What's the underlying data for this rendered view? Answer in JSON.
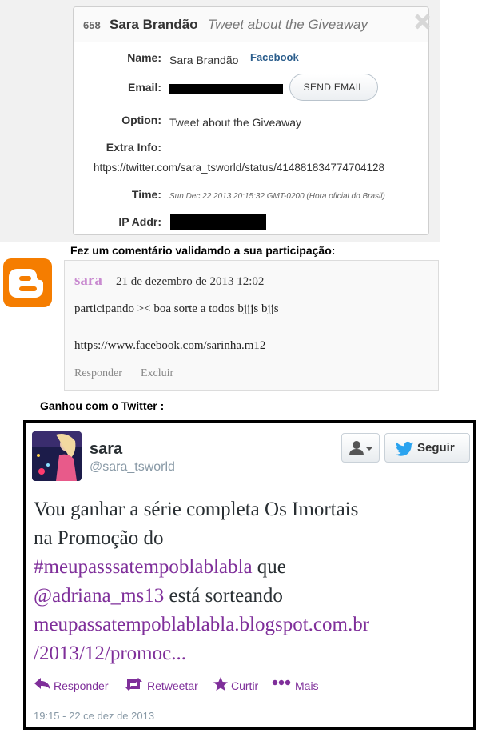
{
  "entry": {
    "id": "658",
    "name": "Sara Brandão",
    "option_title": "Tweet about the Giveaway",
    "labels": {
      "name": "Name:",
      "email": "Email:",
      "option": "Option:",
      "extra": "Extra Info:",
      "time": "Time:",
      "ip": "IP Addr:"
    },
    "name_value": "Sara Brandão",
    "facebook_link": "Facebook",
    "send_email_label": "SEND EMAIL",
    "option_value": "Tweet about the Giveaway",
    "extra_value": "https://twitter.com/sara_tsworld/status/414881834774704128",
    "time_value": "Sun Dec 22 2013 20:15:32 GMT-0200 (Hora oficial do Brasil)"
  },
  "comment": {
    "caption": "Fez um comentário validamdo a sua participação:",
    "author": "sara",
    "date": "21 de dezembro de 2013 12:02",
    "text1": "participando >< boa sorte a todos bjjjs bjjs",
    "text2": "https://www.facebook.com/sarinha.m12",
    "reply": "Responder",
    "delete": "Excluir"
  },
  "tweet": {
    "caption": "Ganhou com o Twitter :",
    "name": "sara",
    "handle": "@sara_tsworld",
    "follow_label": "Seguir",
    "body": {
      "l1": "Vou ganhar a série completa Os Imortais",
      "l2": "na Promoção do",
      "hashtag": "#meupasssatempoblablabla",
      "que": " que",
      "mention": "@adriana_ms13",
      "sorteando": " está sorteando",
      "url1": "meupassatempoblablabla.blogspot.com.br",
      "url2": "/2013/12/promoc..."
    },
    "actions": {
      "reply": "Responder",
      "retweet": "Retweetar",
      "favorite": "Curtir",
      "more": "Mais"
    },
    "timestamp": "19:15 - 22 ce dez de 2013"
  },
  "colors": {
    "blogger": "#f57d00",
    "twitter_link": "#7f2f9a",
    "comment_author": "#c98bd0",
    "facebook_link": "#2a5d8c"
  }
}
